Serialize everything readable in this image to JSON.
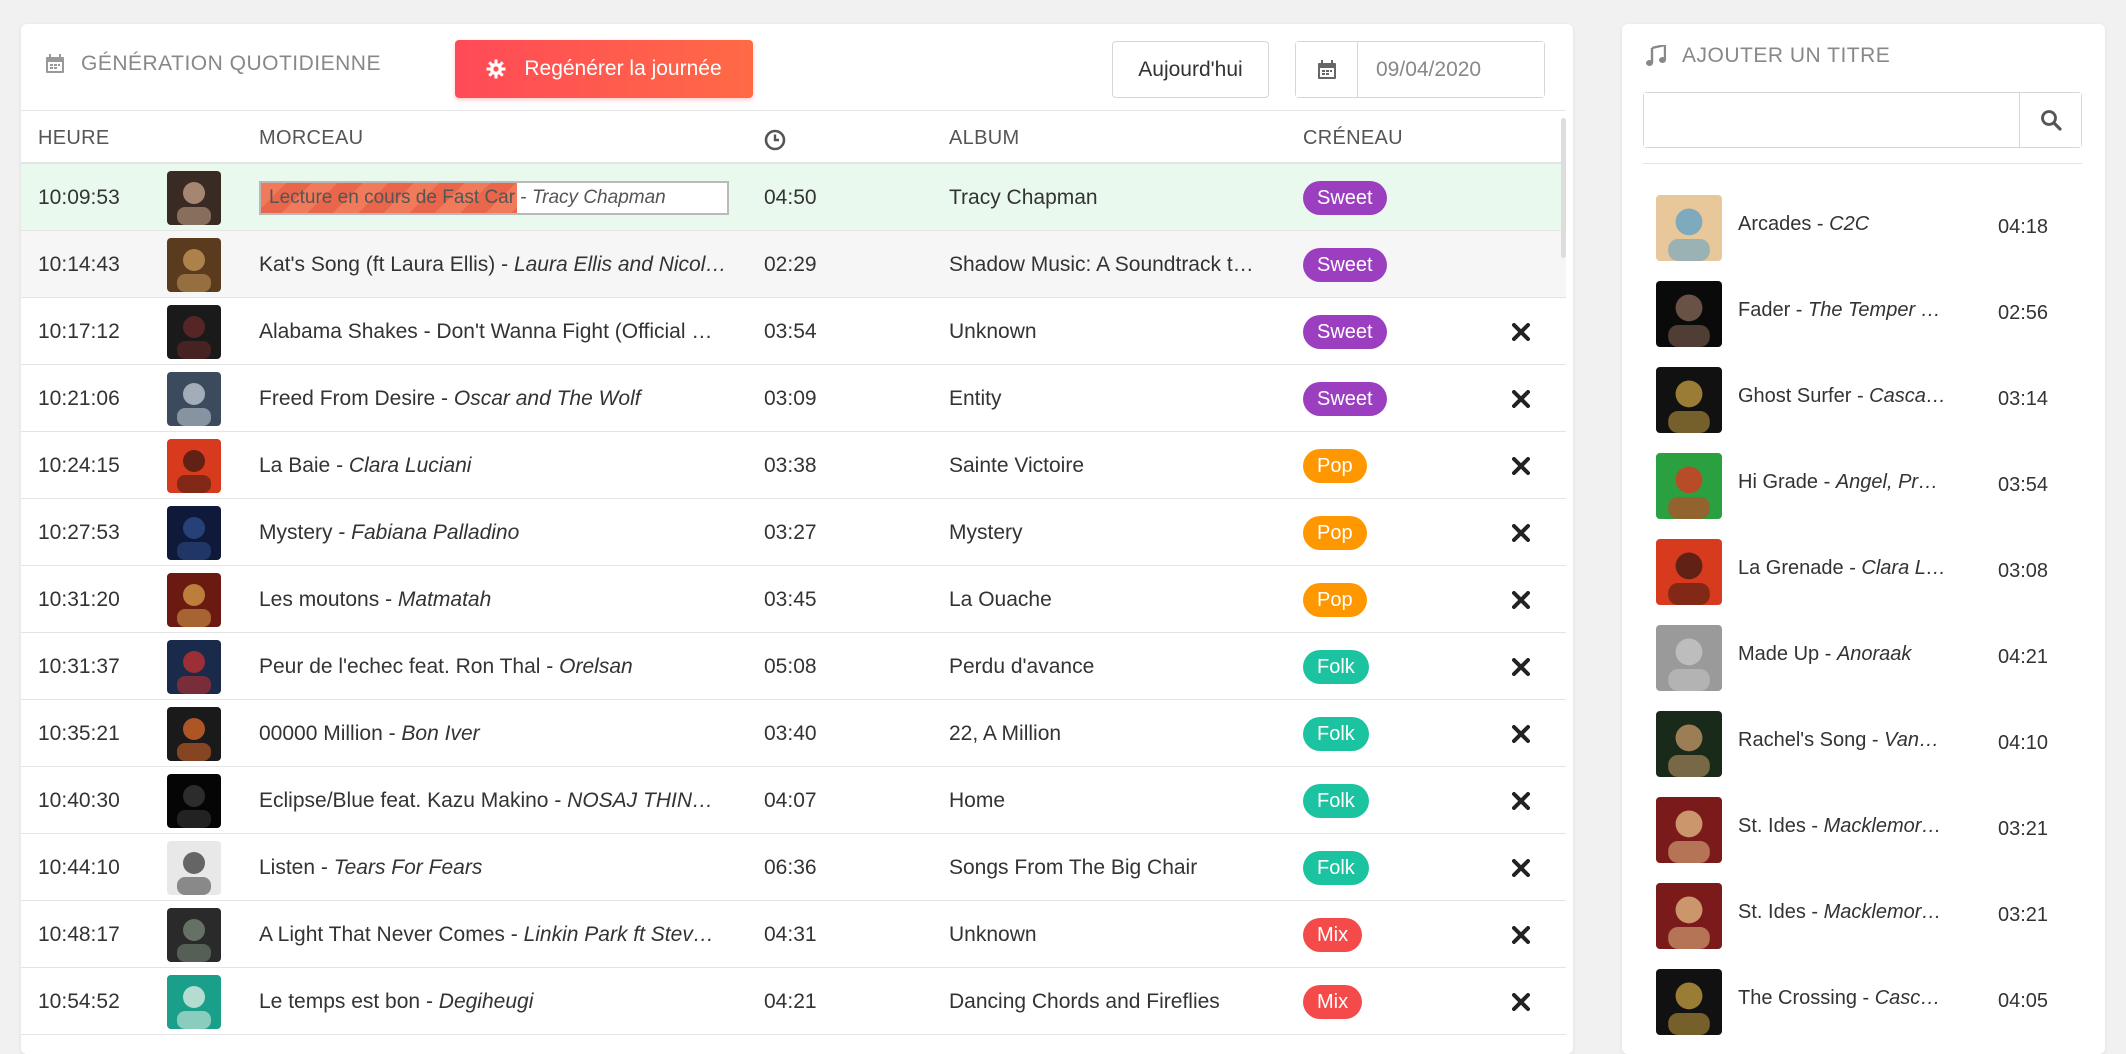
{
  "toolbar": {
    "title": "GÉNÉRATION QUOTIDIENNE",
    "regen_label": "Regénérer la journée",
    "today_label": "Aujourd'hui",
    "date_value": "09/04/2020"
  },
  "table": {
    "headers": {
      "time": "HEURE",
      "track": "MORCEAU",
      "album": "ALBUM",
      "slot": "CRÉNEAU"
    },
    "rows": [
      {
        "time": "10:09:53",
        "playing": true,
        "progress_title": "Lecture en cours de Fast Car",
        "progress_artist": "Tracy Chapman",
        "progress": 0.55,
        "title": "",
        "artist": "",
        "duration": "04:50",
        "album": "Tracy Chapman",
        "slot": "Sweet",
        "color": "#9b3fc0",
        "thumb": [
          "#3a2a24",
          "#c9a58c"
        ]
      },
      {
        "time": "10:14:43",
        "title": "Kat's Song (ft Laura Ellis)",
        "artist": "Laura Ellis and Nicol…",
        "duration": "02:29",
        "album": "Shadow Music: A Soundtrack t…",
        "slot": "Sweet",
        "color": "#9b3fc0",
        "thumb": [
          "#5a3b1e",
          "#c89a5c"
        ]
      },
      {
        "time": "10:17:12",
        "title": "Alabama Shakes - Don't Wanna Fight (Official …",
        "artist": "",
        "duration": "03:54",
        "album": "Unknown",
        "slot": "Sweet",
        "color": "#9b3fc0",
        "thumb": [
          "#1a1a1a",
          "#6b2a2a"
        ]
      },
      {
        "time": "10:21:06",
        "title": "Freed From Desire",
        "artist": "Oscar and The Wolf",
        "duration": "03:09",
        "album": "Entity",
        "slot": "Sweet",
        "color": "#9b3fc0",
        "thumb": [
          "#3b4a5c",
          "#c7cfd8"
        ]
      },
      {
        "time": "10:24:15",
        "title": "La Baie",
        "artist": "Clara Luciani",
        "duration": "03:38",
        "album": "Sainte Victoire",
        "slot": "Pop",
        "color": "#ff9800",
        "thumb": [
          "#d83a1e",
          "#3a1a12"
        ]
      },
      {
        "time": "10:27:53",
        "title": "Mystery",
        "artist": "Fabiana Palladino",
        "duration": "03:27",
        "album": "Mystery",
        "slot": "Pop",
        "color": "#ff9800",
        "thumb": [
          "#0f1a3a",
          "#2e4f8c"
        ]
      },
      {
        "time": "10:31:20",
        "title": "Les moutons",
        "artist": "Matmatah",
        "duration": "03:45",
        "album": "La Ouache",
        "slot": "Pop",
        "color": "#ff9800",
        "thumb": [
          "#6b1a12",
          "#d8a04a"
        ]
      },
      {
        "time": "10:31:37",
        "title": "Peur de l'echec feat. Ron Thal",
        "artist": "Orelsan",
        "duration": "05:08",
        "album": "Perdu d'avance",
        "slot": "Folk",
        "color": "#1cc3a0",
        "thumb": [
          "#1a2a4a",
          "#c83030"
        ]
      },
      {
        "time": "10:35:21",
        "title": "00000 Million",
        "artist": "Bon Iver",
        "duration": "03:40",
        "album": "22, A Million",
        "slot": "Folk",
        "color": "#1cc3a0",
        "thumb": [
          "#1a1a1a",
          "#e06a2a"
        ]
      },
      {
        "time": "10:40:30",
        "title": "Eclipse/Blue feat. Kazu Makino",
        "artist": "NOSAJ THIN…",
        "duration": "04:07",
        "album": "Home",
        "slot": "Folk",
        "color": "#1cc3a0",
        "thumb": [
          "#050505",
          "#3a3a3a"
        ]
      },
      {
        "time": "10:44:10",
        "title": "Listen",
        "artist": "Tears For Fears",
        "duration": "06:36",
        "album": "Songs From The Big Chair",
        "slot": "Folk",
        "color": "#1cc3a0",
        "thumb": [
          "#e8e8e8",
          "#3a3a3a"
        ]
      },
      {
        "time": "10:48:17",
        "title": "A Light That Never Comes",
        "artist": "Linkin Park ft Stev…",
        "duration": "04:31",
        "album": "Unknown",
        "slot": "Mix",
        "color": "#f44a4a",
        "thumb": [
          "#2a2a2a",
          "#7a8a7a"
        ]
      },
      {
        "time": "10:54:52",
        "title": "Le temps est bon",
        "artist": "Degiheugi",
        "duration": "04:21",
        "album": "Dancing Chords and Fireflies",
        "slot": "Mix",
        "color": "#f44a4a",
        "thumb": [
          "#1aa08a",
          "#e8f0e8"
        ]
      }
    ]
  },
  "sidebar": {
    "title": "AJOUTER UN TITRE",
    "search_value": "",
    "tracks": [
      {
        "title": "Arcades",
        "artist": "C2C",
        "duration": "04:18",
        "thumb": [
          "#e8c89a",
          "#5aa0c8"
        ]
      },
      {
        "title": "Fader",
        "artist": "The Temper …",
        "duration": "02:56",
        "thumb": [
          "#0a0a0a",
          "#8a6a5a"
        ]
      },
      {
        "title": "Ghost Surfer",
        "artist": "Casca…",
        "duration": "03:14",
        "thumb": [
          "#111111",
          "#c8a040"
        ]
      },
      {
        "title": "Hi Grade",
        "artist": "Angel, Pr…",
        "duration": "03:54",
        "thumb": [
          "#2aa040",
          "#e83020"
        ]
      },
      {
        "title": "La Grenade",
        "artist": "Clara L…",
        "duration": "03:08",
        "thumb": [
          "#d83a1e",
          "#3a1a12"
        ]
      },
      {
        "title": "Made Up",
        "artist": "Anoraak",
        "duration": "04:21",
        "thumb": [
          "#9a9a9a",
          "#c8c8c8"
        ]
      },
      {
        "title": "Rachel's Song",
        "artist": "Van…",
        "duration": "04:10",
        "thumb": [
          "#1a2a1a",
          "#c89a6a"
        ]
      },
      {
        "title": "St. Ides",
        "artist": "Macklemor…",
        "duration": "03:21",
        "thumb": [
          "#7a1a1a",
          "#e8c08a"
        ]
      },
      {
        "title": "St. Ides",
        "artist": "Macklemor…",
        "duration": "03:21",
        "thumb": [
          "#7a1a1a",
          "#e8c08a"
        ]
      },
      {
        "title": "The Crossing",
        "artist": "Casc…",
        "duration": "04:05",
        "thumb": [
          "#111111",
          "#c8a040"
        ]
      }
    ]
  }
}
